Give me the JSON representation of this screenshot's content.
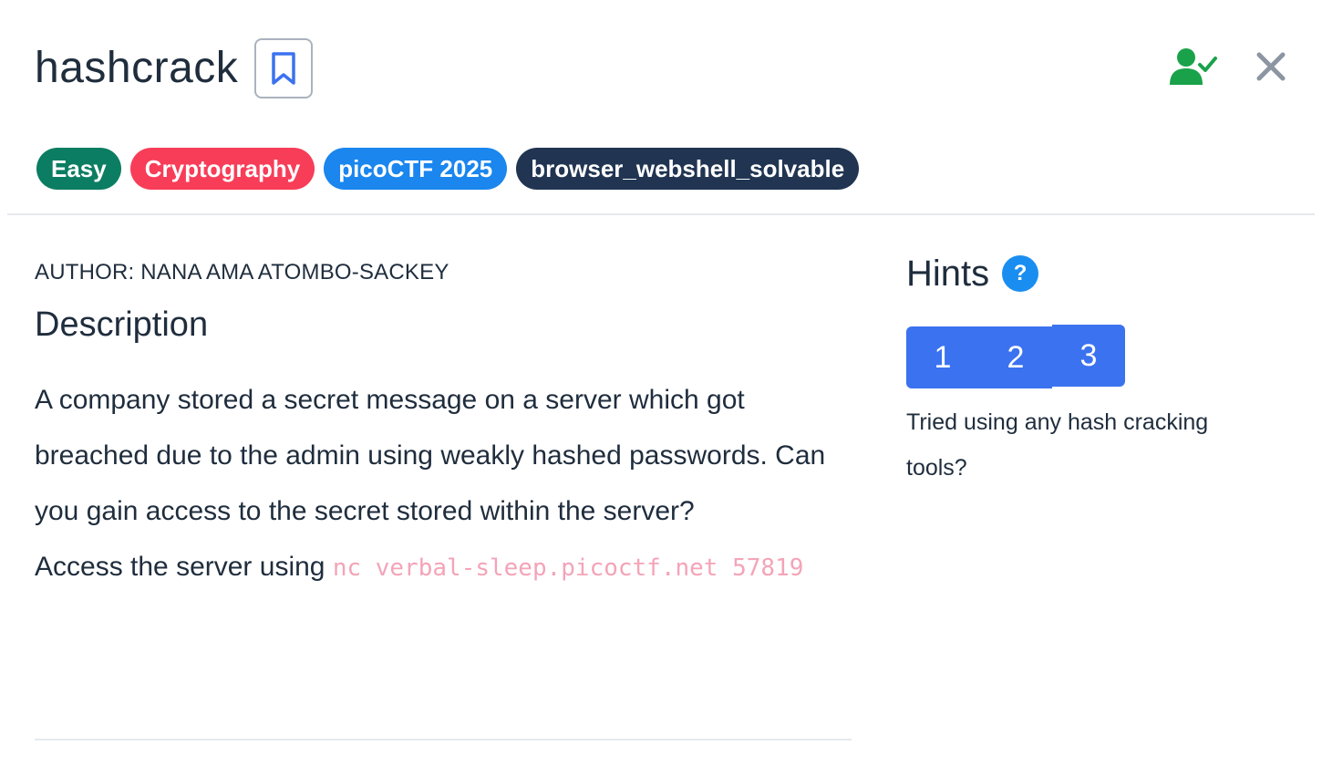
{
  "challenge": {
    "title": "hashcrack"
  },
  "tags": [
    {
      "label": "Easy",
      "color": "#0b7d62"
    },
    {
      "label": "Cryptography",
      "color": "#f83d58"
    },
    {
      "label": "picoCTF 2025",
      "color": "#1a86ee"
    },
    {
      "label": "browser_webshell_solvable",
      "color": "#213552"
    }
  ],
  "icons": {
    "bookmark": "bookmark-icon",
    "solved": "user-check-icon",
    "close": "close-icon",
    "help": "question-circle-icon"
  },
  "colors": {
    "accent_blue": "#3b72f0",
    "solved_green": "#1aa24a",
    "code_pink": "#f4a4b8"
  },
  "main": {
    "author": "AUTHOR: NANA AMA ATOMBO-SACKEY",
    "description_heading": "Description",
    "description_text": "A company stored a secret message on a server which got breached due to the admin using weakly hashed passwords. Can you gain access to the secret stored within the server?",
    "access_prefix": "Access the server using ",
    "access_command": "nc verbal-sleep.picoctf.net 57819"
  },
  "hints": {
    "title": "Hints",
    "help_label": "?",
    "tabs": [
      "1",
      "2",
      "3"
    ],
    "active_text": "Tried using any hash cracking tools?"
  }
}
